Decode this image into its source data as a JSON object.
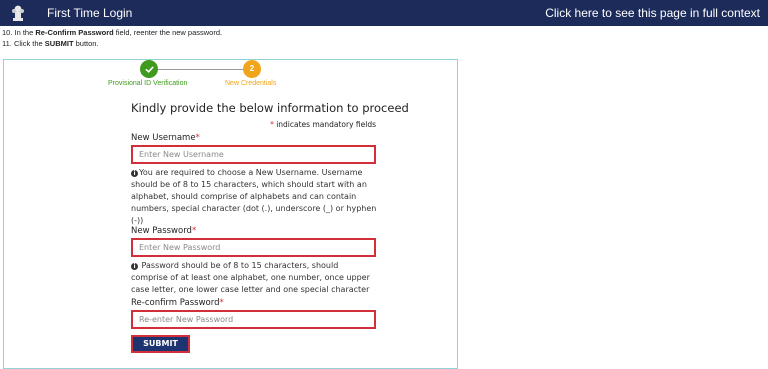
{
  "header": {
    "title": "First Time Login",
    "context_link": "Click here to see this page in full context"
  },
  "instructions": [
    {
      "prefix": "10. In the ",
      "bold": "Re-Confirm Password",
      "suffix": " field, reenter the new password."
    },
    {
      "prefix": "11. Click the ",
      "bold": "SUBMIT",
      "suffix": " button."
    }
  ],
  "stepper": {
    "steps": [
      {
        "label": "Provisional ID Verification",
        "icon": "check-icon",
        "status": "completed",
        "color": "#3f9a1e"
      },
      {
        "label": "New Credentials",
        "number": "2",
        "status": "current",
        "color": "#f0a51a"
      }
    ]
  },
  "form": {
    "heading": "Kindly provide the below information to proceed",
    "mandatory_note": " indicates mandatory fields",
    "required_marker": "*",
    "username": {
      "label": "New Username",
      "placeholder": "Enter New Username",
      "help": "You are required to choose a New Username. Username should be of 8 to 15 characters, which should start with an alphabet, should comprise of alphabets and can contain numbers, special character (dot (.), underscore (_) or hyphen (-))"
    },
    "password": {
      "label": "New Password",
      "placeholder": "Enter New Password",
      "help": " Password should be of 8 to 15 characters, should comprise of at least one alphabet, one number, once upper case letter, one lower case letter and one special character"
    },
    "confirm_password": {
      "label": "Re-confirm Password",
      "placeholder": "Re-enter New Password"
    },
    "submit_label": "SUBMIT"
  },
  "colors": {
    "header_bg": "#1c2b5a",
    "highlight_border": "#d32f3a",
    "button_bg": "#1d3470",
    "frame_border": "#8fd4d4"
  }
}
